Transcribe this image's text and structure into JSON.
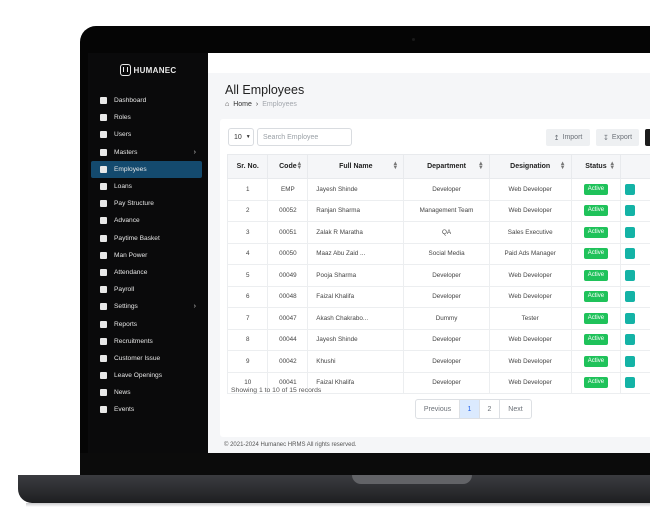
{
  "app": {
    "brand": "HUMANEC"
  },
  "sidebar": {
    "items": [
      {
        "label": "Dashboard",
        "icon": "dashboard-icon"
      },
      {
        "label": "Roles",
        "icon": "roles-icon"
      },
      {
        "label": "Users",
        "icon": "users-icon"
      },
      {
        "label": "Masters",
        "icon": "masters-icon",
        "has_submenu": true
      },
      {
        "label": "Employees",
        "icon": "employees-icon",
        "active": true
      },
      {
        "label": "Loans",
        "icon": "loans-icon"
      },
      {
        "label": "Pay Structure",
        "icon": "pay-structure-icon"
      },
      {
        "label": "Advance",
        "icon": "advance-icon"
      },
      {
        "label": "Paytime Basket",
        "icon": "basket-icon"
      },
      {
        "label": "Man Power",
        "icon": "manpower-icon"
      },
      {
        "label": "Attendance",
        "icon": "attendance-icon"
      },
      {
        "label": "Payroll",
        "icon": "payroll-icon"
      },
      {
        "label": "Settings",
        "icon": "settings-icon",
        "has_submenu": true
      },
      {
        "label": "Reports",
        "icon": "reports-icon"
      },
      {
        "label": "Recruitments",
        "icon": "recruitments-icon"
      },
      {
        "label": "Customer Issue",
        "icon": "customer-issue-icon"
      },
      {
        "label": "Leave Openings",
        "icon": "leave-icon"
      },
      {
        "label": "News",
        "icon": "news-icon"
      },
      {
        "label": "Events",
        "icon": "events-icon"
      }
    ],
    "submenu_glyph": "›"
  },
  "header": {
    "title": "All Employees",
    "breadcrumb": {
      "home": "Home",
      "separator": "›",
      "current": "Employees"
    }
  },
  "toolbar": {
    "page_size": "10",
    "search_placeholder": "Search Employee",
    "import_label": "Import",
    "export_label": "Export"
  },
  "table": {
    "columns": [
      "Sr. No.",
      "Code",
      "Full Name",
      "Department",
      "Designation",
      "Status",
      ""
    ],
    "rows": [
      {
        "sr": "1",
        "code": "EMP",
        "name": "Jayesh Shinde",
        "dept": "Developer",
        "designation": "Web Developer",
        "status": "Active"
      },
      {
        "sr": "2",
        "code": "00052",
        "name": "Ranjan Sharma",
        "dept": "Management Team",
        "designation": "Web Developer",
        "status": "Active"
      },
      {
        "sr": "3",
        "code": "00051",
        "name": "Zalak R Maratha",
        "dept": "QA",
        "designation": "Sales Executive",
        "status": "Active"
      },
      {
        "sr": "4",
        "code": "00050",
        "name": "Maaz Abu Zaid ...",
        "dept": "Social Media",
        "designation": "Paid Ads Manager",
        "status": "Active"
      },
      {
        "sr": "5",
        "code": "00049",
        "name": "Pooja Sharma",
        "dept": "Developer",
        "designation": "Web Developer",
        "status": "Active"
      },
      {
        "sr": "6",
        "code": "00048",
        "name": "Faizal Khalifa",
        "dept": "Developer",
        "designation": "Web Developer",
        "status": "Active"
      },
      {
        "sr": "7",
        "code": "00047",
        "name": "Akash Chakrabo...",
        "dept": "Dummy",
        "designation": "Tester",
        "status": "Active"
      },
      {
        "sr": "8",
        "code": "00044",
        "name": "Jayesh Shinde",
        "dept": "Developer",
        "designation": "Web Developer",
        "status": "Active"
      },
      {
        "sr": "9",
        "code": "00042",
        "name": "Khushi",
        "dept": "Developer",
        "designation": "Web Developer",
        "status": "Active"
      },
      {
        "sr": "10",
        "code": "00041",
        "name": "Faizal Khalifa",
        "dept": "Developer",
        "designation": "Web Developer",
        "status": "Active"
      }
    ]
  },
  "pagination": {
    "summary": "Showing 1 to 10 of 15 records",
    "previous": "Previous",
    "pages": [
      "1",
      "2"
    ],
    "current_page": "1",
    "next": "Next"
  },
  "footer": {
    "text": "© 2021-2024  Humanec HRMS All rights reserved."
  },
  "colors": {
    "active_nav": "#144a6e",
    "status_active": "#1fc25a",
    "action": "#14b3a6",
    "current_page_bg": "#dbeafe"
  }
}
